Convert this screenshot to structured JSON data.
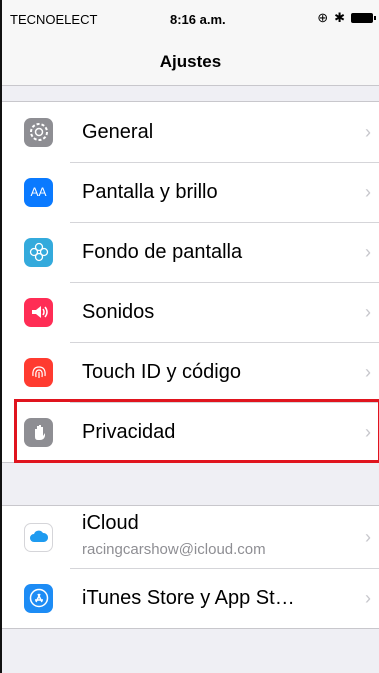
{
  "status": {
    "carrier": "TECNOELECT",
    "time": "8:16 a.m."
  },
  "nav": {
    "title": "Ajustes"
  },
  "group1": [
    {
      "label": "General",
      "icon": "gear-icon",
      "color": "#8e8e93"
    },
    {
      "label": "Pantalla y brillo",
      "icon": "display-aa-icon",
      "color": "#0a7aff"
    },
    {
      "label": "Fondo de pantalla",
      "icon": "flower-icon",
      "color": "#34aadc"
    },
    {
      "label": "Sonidos",
      "icon": "speaker-icon",
      "color": "#ff2d55"
    },
    {
      "label": "Touch ID y código",
      "icon": "fingerprint-icon",
      "color": "#ff3b30"
    },
    {
      "label": "Privacidad",
      "icon": "hand-icon",
      "color": "#8e8e93"
    }
  ],
  "group2": [
    {
      "label": "iCloud",
      "sublabel": "racingcarshow@icloud.com",
      "icon": "cloud-icon",
      "color": "#ffffff"
    },
    {
      "label": "iTunes Store y App St…",
      "icon": "app-store-icon",
      "color": "#1d8cf5"
    }
  ],
  "icon_text": {
    "aa": "AA"
  },
  "highlight": {
    "target": "Privacidad",
    "color": "#e0141e"
  }
}
